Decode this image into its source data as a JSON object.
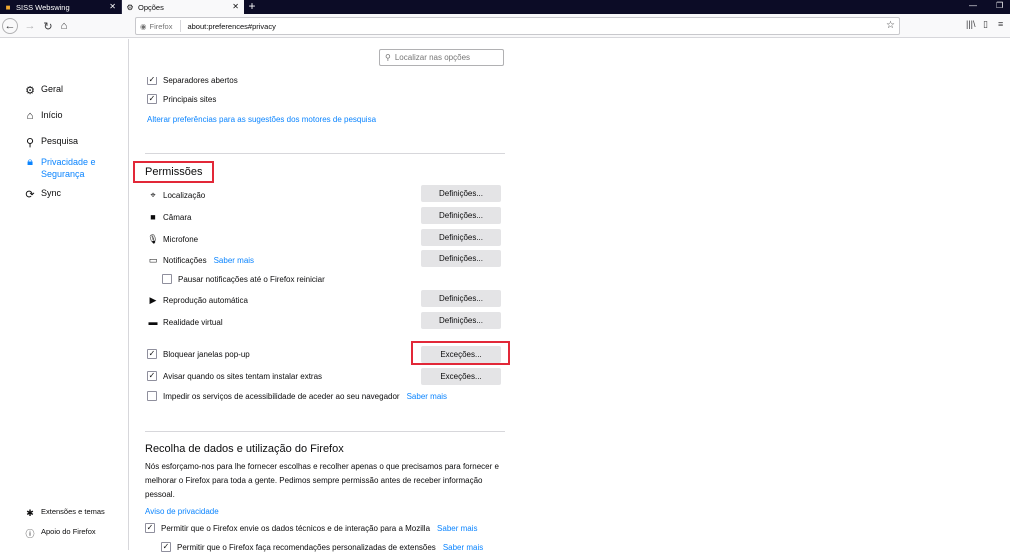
{
  "tabs": [
    {
      "label": "SISS Webswing"
    },
    {
      "label": "Opções"
    }
  ],
  "urlbar": {
    "identity": "Firefox",
    "url": "about:preferences#privacy"
  },
  "sidebar": {
    "items": [
      {
        "label": "Geral"
      },
      {
        "label": "Início"
      },
      {
        "label": "Pesquisa"
      },
      {
        "label": "Privacidade e Segurança"
      },
      {
        "label": "Sync"
      }
    ],
    "footer": [
      {
        "label": "Extensões e temas"
      },
      {
        "label": "Apoio do Firefox"
      }
    ]
  },
  "search": {
    "placeholder": "Localizar nas opções"
  },
  "top_partial": {
    "cut_label": "Separadores abertos",
    "top_sites": "Principais sites",
    "link": "Alterar preferências para as sugestões dos motores de pesquisa"
  },
  "permissions": {
    "title": "Permissões",
    "button_label": "Definições...",
    "items": [
      {
        "label": "Localização"
      },
      {
        "label": "Câmara"
      },
      {
        "label": "Microfone"
      },
      {
        "label": "Notificações",
        "link": "Saber mais"
      },
      {
        "label": "Reprodução automática"
      },
      {
        "label": "Realidade virtual"
      }
    ],
    "pause_notifications": "Pausar notificações até o Firefox reiniciar",
    "block_popups": "Bloquear janelas pop-up",
    "warn_addons": "Avisar quando os sites tentam instalar extras",
    "exceptions_label": "Exceções...",
    "accessibility": "Impedir os serviços de acessibilidade de aceder ao seu navegador",
    "accessibility_link": "Saber mais"
  },
  "data_collection": {
    "title": "Recolha de dados e utilização do Firefox",
    "desc": "Nós esforçamo-nos para lhe fornecer escolhas e recolher apenas o que precisamos para fornecer e melhorar o Firefox para toda a gente. Pedimos sempre permissão antes de receber informação pessoal.",
    "privacy_link": "Aviso de privacidade",
    "opt1": "Permitir que o Firefox envie os dados técnicos e de interação para a Mozilla",
    "opt1_link": "Saber mais",
    "opt2": "Permitir que o Firefox faça recomendações personalizadas de extensões",
    "opt2_link": "Saber mais"
  },
  "colors": {
    "accent": "#0a84ff",
    "highlight": "#e22838",
    "tabbar": "#0c0c26"
  }
}
